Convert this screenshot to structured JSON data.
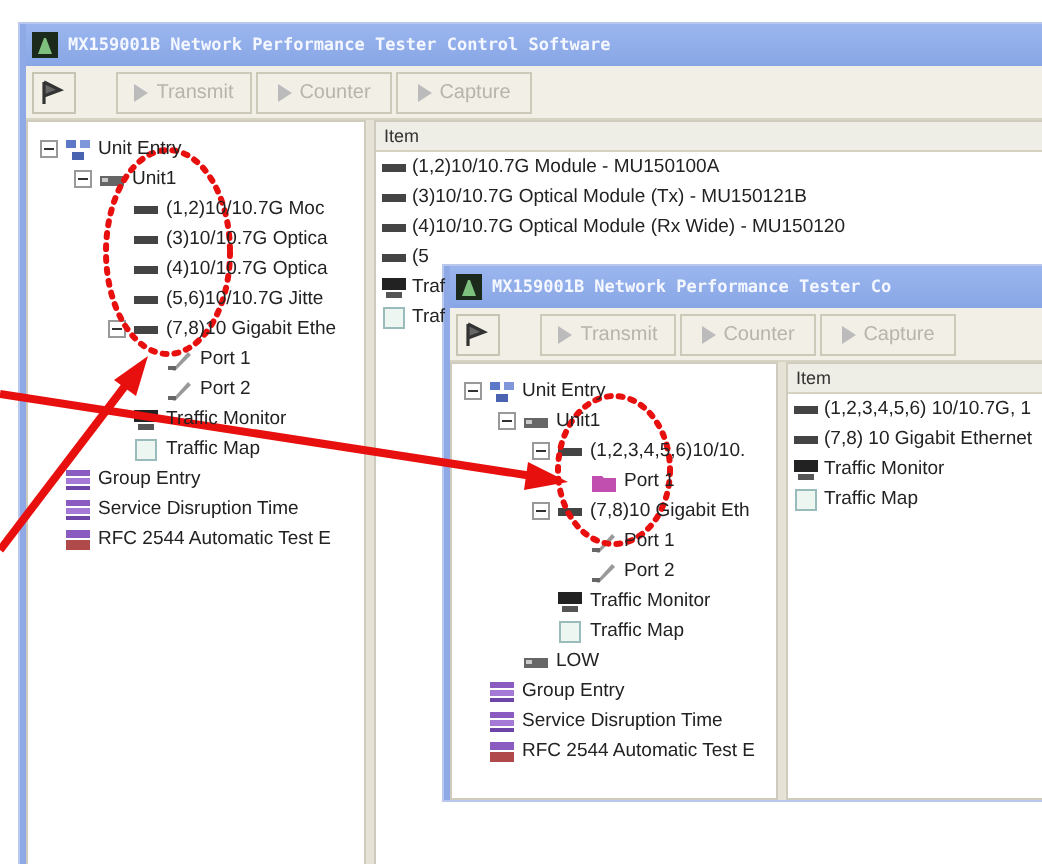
{
  "windows": [
    {
      "title": "MX159001B Network Performance Tester Control Software",
      "toolbar": [
        {
          "label": "Transmit",
          "disabled": true
        },
        {
          "label": "Counter",
          "disabled": true
        },
        {
          "label": "Capture",
          "disabled": true
        }
      ],
      "tree": [
        {
          "label": "Unit Entry",
          "kind": "entry",
          "expanded": true,
          "children": [
            {
              "label": "Unit1",
              "kind": "unit",
              "expanded": true,
              "children": [
                {
                  "label": "(1,2)10/10.7G Moc",
                  "kind": "module"
                },
                {
                  "label": "(3)10/10.7G Optica",
                  "kind": "module"
                },
                {
                  "label": "(4)10/10.7G Optica",
                  "kind": "module"
                },
                {
                  "label": "(5,6)10/10.7G Jitte",
                  "kind": "module"
                },
                {
                  "label": "(7,8)10 Gigabit Ethe",
                  "kind": "module",
                  "expanded": true,
                  "children": [
                    {
                      "label": "Port 1",
                      "kind": "port"
                    },
                    {
                      "label": "Port 2",
                      "kind": "port"
                    }
                  ]
                },
                {
                  "label": "Traffic Monitor",
                  "kind": "monitor"
                },
                {
                  "label": "Traffic Map",
                  "kind": "map"
                }
              ]
            }
          ]
        },
        {
          "label": "Group Entry",
          "kind": "group"
        },
        {
          "label": "Service Disruption Time",
          "kind": "service"
        },
        {
          "label": "RFC 2544 Automatic Test E",
          "kind": "rfc"
        }
      ],
      "list": {
        "column": "Item",
        "rows": [
          {
            "label": "(1,2)10/10.7G Module - MU150100A",
            "kind": "module"
          },
          {
            "label": "(3)10/10.7G Optical Module (Tx) - MU150121B",
            "kind": "module"
          },
          {
            "label": "(4)10/10.7G Optical Module (Rx Wide) - MU150120",
            "kind": "module"
          },
          {
            "label": "(5",
            "kind": "module"
          },
          {
            "label": "Traf",
            "kind": "monitor"
          },
          {
            "label": "Traf",
            "kind": "map"
          }
        ]
      }
    },
    {
      "title": "MX159001B Network Performance Tester Co",
      "toolbar": [
        {
          "label": "Transmit",
          "disabled": true
        },
        {
          "label": "Counter",
          "disabled": true
        },
        {
          "label": "Capture",
          "disabled": true
        }
      ],
      "tree": [
        {
          "label": "Unit Entry",
          "kind": "entry",
          "expanded": true,
          "children": [
            {
              "label": "Unit1",
              "kind": "unit",
              "expanded": true,
              "children": [
                {
                  "label": "(1,2,3,4,5,6)10/10.",
                  "kind": "module",
                  "expanded": true,
                  "children": [
                    {
                      "label": "Port 1",
                      "kind": "port-active"
                    }
                  ]
                },
                {
                  "label": "(7,8)10 Gigabit Eth",
                  "kind": "module",
                  "expanded": true,
                  "children": [
                    {
                      "label": "Port 1",
                      "kind": "port"
                    },
                    {
                      "label": "Port 2",
                      "kind": "port"
                    }
                  ]
                },
                {
                  "label": "Traffic Monitor",
                  "kind": "monitor"
                },
                {
                  "label": "Traffic Map",
                  "kind": "map"
                }
              ]
            },
            {
              "label": "LOW",
              "kind": "unit"
            }
          ]
        },
        {
          "label": "Group Entry",
          "kind": "group"
        },
        {
          "label": "Service Disruption Time",
          "kind": "service"
        },
        {
          "label": "RFC 2544 Automatic Test E",
          "kind": "rfc"
        }
      ],
      "list": {
        "column": "Item",
        "rows": [
          {
            "label": "(1,2,3,4,5,6) 10/10.7G, 1",
            "kind": "module"
          },
          {
            "label": "(7,8) 10 Gigabit Ethernet",
            "kind": "module"
          },
          {
            "label": "Traffic Monitor",
            "kind": "monitor"
          },
          {
            "label": "Traffic Map",
            "kind": "map"
          }
        ]
      }
    }
  ]
}
